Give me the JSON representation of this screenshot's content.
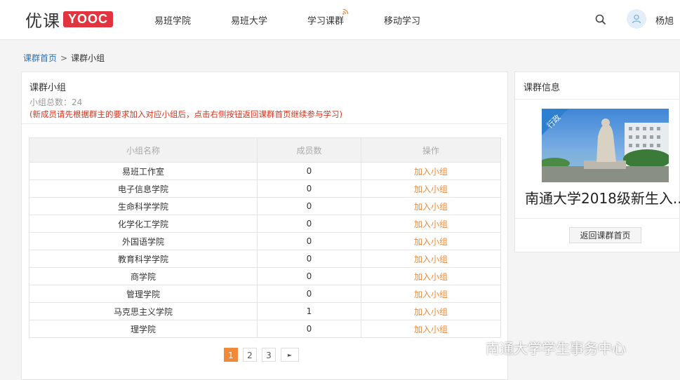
{
  "header": {
    "logo_cn": "优课",
    "logo_brand": "YOOC",
    "nav": [
      "易班学院",
      "易班大学",
      "学习课群",
      "移动学习"
    ],
    "user": "杨旭"
  },
  "breadcrumb": {
    "home": "课群首页",
    "separator": ">",
    "current": "课群小组"
  },
  "main": {
    "title": "课群小组",
    "count": "小组总数：24",
    "notice": "(新成员请先根据群主的要求加入对应小组后，点击右侧按钮返回课群首页继续参与学习)",
    "columns": [
      "小组名称",
      "成员数",
      "操作"
    ],
    "rows": [
      {
        "name": "易班工作室",
        "members": "0",
        "action": "加入小组"
      },
      {
        "name": "电子信息学院",
        "members": "0",
        "action": "加入小组"
      },
      {
        "name": "生命科学学院",
        "members": "0",
        "action": "加入小组"
      },
      {
        "name": "化学化工学院",
        "members": "0",
        "action": "加入小组"
      },
      {
        "name": "外国语学院",
        "members": "0",
        "action": "加入小组"
      },
      {
        "name": "教育科学学院",
        "members": "0",
        "action": "加入小组"
      },
      {
        "name": "商学院",
        "members": "0",
        "action": "加入小组"
      },
      {
        "name": "管理学院",
        "members": "0",
        "action": "加入小组"
      },
      {
        "name": "马克思主义学院",
        "members": "1",
        "action": "加入小组"
      },
      {
        "name": "理学院",
        "members": "0",
        "action": "加入小组"
      }
    ],
    "pagination": {
      "pages": [
        "1",
        "2",
        "3"
      ],
      "current": "1",
      "next": "►"
    }
  },
  "sidebar": {
    "title": "课群信息",
    "ribbon": "行政",
    "course_name": "南通大学2018级新生入...",
    "back_button": "返回课群首页"
  },
  "watermark": "南通大学学生事务中心",
  "colors": {
    "brand_red": "#e0353e",
    "accent_orange": "#f08a3a",
    "link_blue": "#2a72b5",
    "notice_red": "#d8341c"
  }
}
